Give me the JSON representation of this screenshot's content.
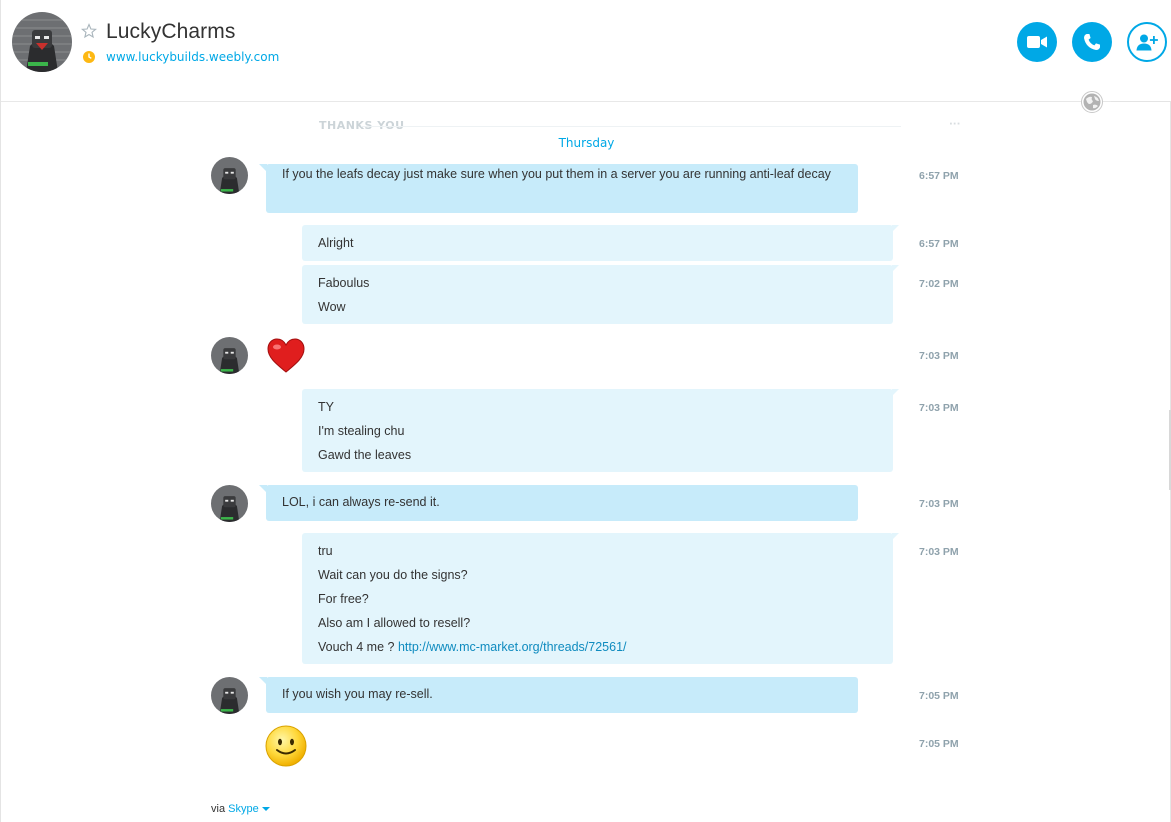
{
  "header": {
    "contact_name": "LuckyCharms",
    "mood_link": "www.luckybuilds.weebly.com",
    "icons": {
      "favorite": "star-outline-icon",
      "status": "away-clock-icon",
      "video": "video-call-icon",
      "call": "phone-icon",
      "add_people": "add-person-icon",
      "globe": "globe-icon"
    }
  },
  "history": {
    "faded_previous": "THANKS YOU"
  },
  "day_separator": "Thursday",
  "messages": [
    {
      "direction": "incoming",
      "lines": [
        "If you the leafs decay just make sure when you put them in a server you are running anti-leaf decay"
      ],
      "time": "6:57 PM"
    },
    {
      "direction": "outgoing",
      "lines": [
        "Alright"
      ],
      "time": "6:57 PM"
    },
    {
      "direction": "outgoing",
      "lines": [
        "Faboulus",
        "Wow"
      ],
      "time": "7:02 PM"
    },
    {
      "direction": "incoming",
      "emoticon": "heart-emoticon",
      "time": "7:03 PM"
    },
    {
      "direction": "outgoing",
      "lines": [
        "TY",
        "I'm stealing chu",
        "Gawd the leaves"
      ],
      "time": "7:03 PM"
    },
    {
      "direction": "incoming",
      "lines": [
        "LOL, i can always re-send it."
      ],
      "time": "7:03 PM"
    },
    {
      "direction": "outgoing",
      "lines": [
        "tru",
        "Wait can you do the signs?",
        "For free?",
        "Also am I allowed to resell?"
      ],
      "last_line_prefix": "Vouch 4 me ?",
      "last_line_link": "http://www.mc-market.org/threads/72561/",
      "time": "7:03 PM"
    },
    {
      "direction": "incoming",
      "lines": [
        "If you wish you may re-sell."
      ],
      "time": "7:05 PM"
    },
    {
      "direction": "incoming",
      "emoticon": "smile-emoticon",
      "time": "7:05 PM"
    }
  ],
  "footer": {
    "via_label": "via",
    "via_app": "Skype"
  },
  "colors": {
    "accent": "#00a8e6",
    "incoming_bubble": "#c7ebfa",
    "outgoing_bubble": "#e3f5fc",
    "timestamp": "#8fa2ac"
  }
}
